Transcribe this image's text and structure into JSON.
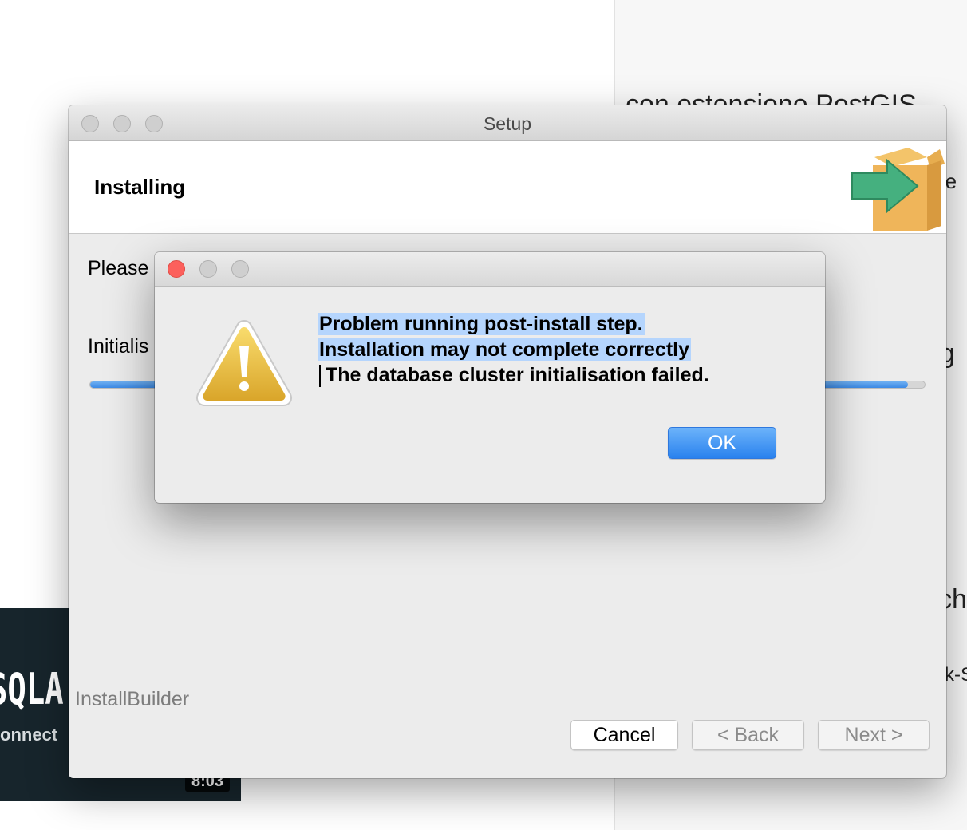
{
  "background": {
    "heading_fragment": "con estensione PostGIS",
    "fragment_right_1": "re",
    "fragment_right_2": "g",
    "fragment_right_3": "ch",
    "fragment_right_4": "k-S",
    "video": {
      "title": "SQLA",
      "subtitle": "onnect",
      "duration": "8:03"
    }
  },
  "setup_window": {
    "title": "Setup",
    "page_heading": "Installing",
    "logo_icon": "installer-box-arrow-icon",
    "please_text": "Please",
    "status_text": "Initialis",
    "progress_fraction": 0.98,
    "brand": "InstallBuilder",
    "buttons": {
      "cancel": "Cancel",
      "back": "< Back",
      "next": "Next >"
    }
  },
  "alert_dialog": {
    "icon": "warning-icon",
    "message_line_1": "Problem running post-install step.",
    "message_line_2": "Installation may not complete correctly",
    "message_line_3": "The database cluster initialisation failed.",
    "ok_label": "OK",
    "selection_color": "#b5d5fd"
  },
  "colors": {
    "close_red": "#fc605c",
    "accent_blue": "#2a82ee",
    "progress_blue": "#3c8ae6"
  }
}
